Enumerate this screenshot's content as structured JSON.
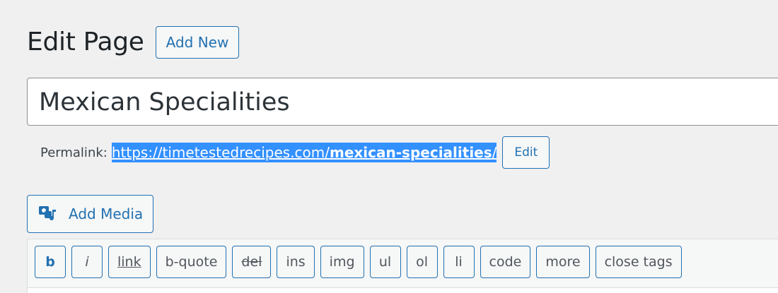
{
  "header": {
    "title": "Edit Page",
    "add_new_label": "Add New"
  },
  "post_title": {
    "value": "Mexican Specialities"
  },
  "permalink": {
    "label": "Permalink:",
    "url_base": "https://timetestedrecipes.com/",
    "slug": "mexican-specialities",
    "trailing": "/",
    "edit_label": "Edit"
  },
  "media": {
    "add_media_label": "Add Media",
    "icon": "add-media-icon"
  },
  "toolbar": {
    "buttons": [
      "b",
      "i",
      "link",
      "b-quote",
      "del",
      "ins",
      "img",
      "ul",
      "ol",
      "li",
      "code",
      "more",
      "close tags"
    ]
  },
  "colors": {
    "accent": "#2271b1",
    "selection": "#3390ff",
    "background": "#f0f0f1"
  }
}
